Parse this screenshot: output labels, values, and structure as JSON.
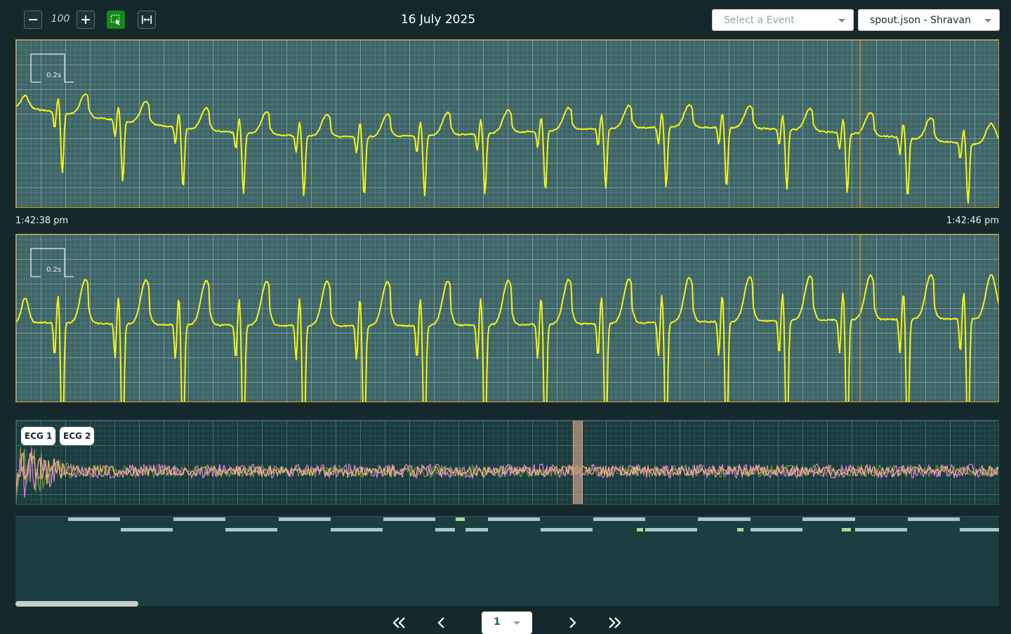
{
  "toolbar": {
    "zoom_value": "100",
    "zoom_out_icon": "minus-icon",
    "zoom_in_icon": "plus-icon",
    "select_tool_icon": "selection-cursor-icon",
    "fit_width_icon": "fit-width-icon",
    "select_tool_active_color": "#118a17"
  },
  "header": {
    "date": "16 July 2025"
  },
  "event_select": {
    "placeholder": "Select a Event"
  },
  "file_select": {
    "value": "spout.json - Shravan"
  },
  "panels": [
    {
      "calibration_label": "0.2s",
      "trace_color": "#f4f416"
    },
    {
      "calibration_label": "0.2s",
      "trace_color": "#f4f416"
    }
  ],
  "time_axis": {
    "start": "1:42:38 pm",
    "end": "1:42:46 pm"
  },
  "overview": {
    "channels": [
      "ECG 1",
      "ECG 2"
    ],
    "colors": {
      "ecg1": "#e47ee0",
      "ecg2": "#6e9a30",
      "blend": "#f1b872"
    }
  },
  "timeline": {
    "bar_color": "#a8c7cc",
    "accent_color": "#a9d79e"
  },
  "pagination": {
    "first_icon": "double-chevron-left-icon",
    "prev_icon": "chevron-left-icon",
    "next_icon": "chevron-right-icon",
    "last_icon": "double-chevron-right-icon",
    "current_page": "1"
  },
  "colors": {
    "background": "#15292c",
    "panel_grid_bg": "#3f6567",
    "panel_border": "#d79a26",
    "cursor_line": "#d79a26"
  }
}
